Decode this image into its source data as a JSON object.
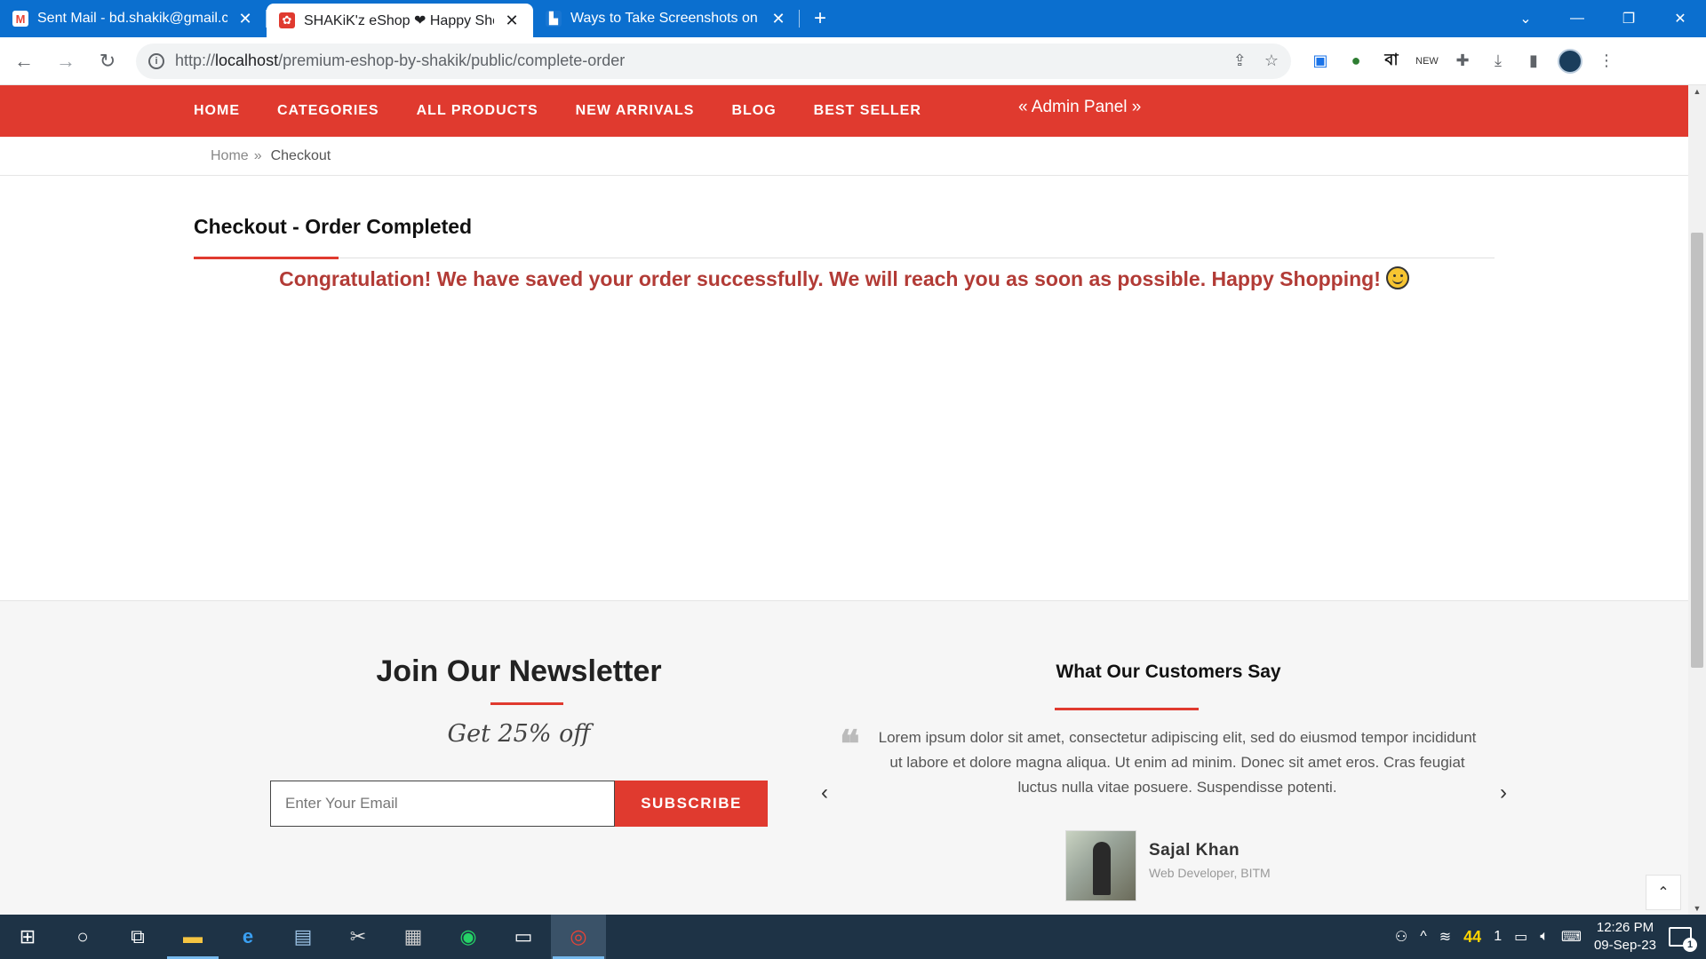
{
  "browser": {
    "tabs": [
      {
        "title": "Sent Mail - bd.shakik@gmail.com",
        "favicon": "gmail-icon",
        "active": false
      },
      {
        "title": "SHAKiK'z eShop ❤ Happy Shopping",
        "favicon": "shop-icon",
        "active": true
      },
      {
        "title": "Ways to Take Screenshots on Windows",
        "favicon": "site-icon",
        "active": false
      }
    ],
    "new_tab": "+",
    "url_prefix": "http://",
    "url_host": "localhost",
    "url_path": "/premium-eshop-by-shakik/public/complete-order"
  },
  "nav": {
    "items": [
      "HOME",
      "CATEGORIES",
      "ALL PRODUCTS",
      "NEW ARRIVALS",
      "BLOG",
      "BEST SELLER"
    ],
    "admin": "« Admin Panel »"
  },
  "breadcrumb": {
    "home": "Home",
    "separator": "»",
    "current": "Checkout"
  },
  "checkout": {
    "title": "Checkout - Order Completed",
    "message": "Congratulation! We have saved your order successfully. We will reach you as soon as possible. Happy Shopping!"
  },
  "newsletter": {
    "title": "Join Our Newsletter",
    "subtitle": "Get 25% off",
    "placeholder": "Enter Your Email",
    "button": "SUBSCRIBE"
  },
  "testimonial": {
    "title": "What Our Customers Say",
    "text": "Lorem ipsum dolor sit amet, consectetur adipiscing elit, sed do eiusmod tempor incididunt ut labore et dolore magna aliqua. Ut enim ad minim. Donec sit amet eros. Cras feugiat luctus nulla vitae posuere. Suspendisse potenti.",
    "name": "Sajal Khan",
    "role": "Web Developer, BITM"
  },
  "taskbar": {
    "tray_num1": "44",
    "tray_num2": "1",
    "time": "12:26 PM",
    "date": "09-Sep-23",
    "notifications": "1"
  },
  "colors": {
    "accent": "#e03a2f",
    "message": "#b23b36",
    "tabbar": "#0b6fcf",
    "taskbar": "#1e3346"
  }
}
